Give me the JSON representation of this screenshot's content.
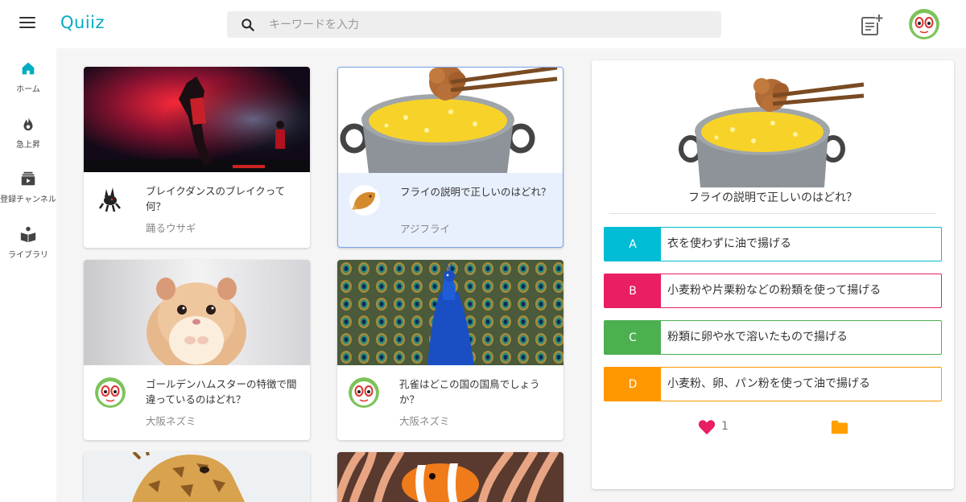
{
  "app": {
    "logo": "Quiiz"
  },
  "search": {
    "placeholder": "キーワードを入力"
  },
  "colors": {
    "accent": "#00acc1",
    "option_a": "#00bcd4",
    "option_b": "#e91e63",
    "option_c": "#4caf50",
    "option_d": "#ff9800",
    "like": "#e91e63",
    "folder": "#ffa000"
  },
  "sidebar": {
    "items": [
      {
        "label": "ホーム",
        "icon": "home-icon"
      },
      {
        "label": "急上昇",
        "icon": "fire-icon"
      },
      {
        "label": "登録チャンネル",
        "icon": "subscriptions-icon"
      },
      {
        "label": "ライブラリ",
        "icon": "library-icon"
      }
    ]
  },
  "cards": [
    {
      "title": "ブレイクダンスのブレイクって何？",
      "author": "踊るウサギ"
    },
    {
      "title": "フライの説明で正しいのはどれ？",
      "author": "アジフライ"
    },
    {
      "title": "ゴールデンハムスターの特徴で間違っているのはどれ？",
      "author": "大阪ネズミ"
    },
    {
      "title": "孔雀はどこの国の国鳥でしょうか？",
      "author": "大阪ネズミ"
    }
  ],
  "quiz": {
    "question": "フライの説明で正しいのはどれ？",
    "options": [
      {
        "key": "A",
        "text": "衣を使わずに油で揚げる"
      },
      {
        "key": "B",
        "text": "小麦粉や片栗粉などの粉類を使って揚げる"
      },
      {
        "key": "C",
        "text": "粉類に卵や水で溶いたもので揚げる"
      },
      {
        "key": "D",
        "text": "小麦粉、卵、パン粉を使って油で揚げる"
      }
    ],
    "likes": "1"
  }
}
